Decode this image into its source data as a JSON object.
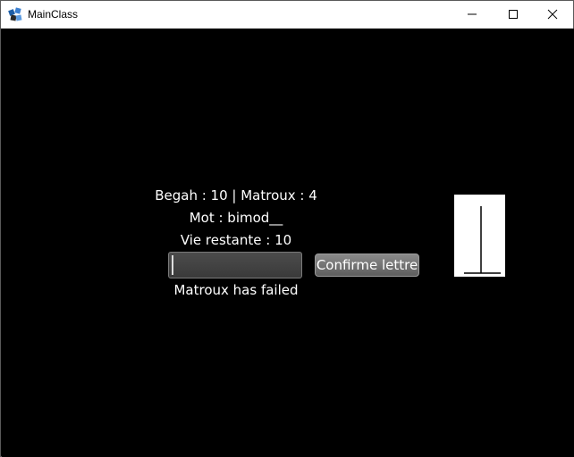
{
  "window": {
    "title": "MainClass",
    "icon": "java-app-icon",
    "controls": [
      "minimize-icon",
      "maximize-icon",
      "close-icon"
    ]
  },
  "game": {
    "score_line": "Begah : 10 | Matroux : 4",
    "word_line": "Mot : bimod__",
    "lives_line": "Vie restante : 10",
    "letter_input_value": "",
    "confirm_label": "Confirme lettre",
    "status_message": "Matroux has failed"
  },
  "hangman": {
    "stage": "gallows-only"
  }
}
